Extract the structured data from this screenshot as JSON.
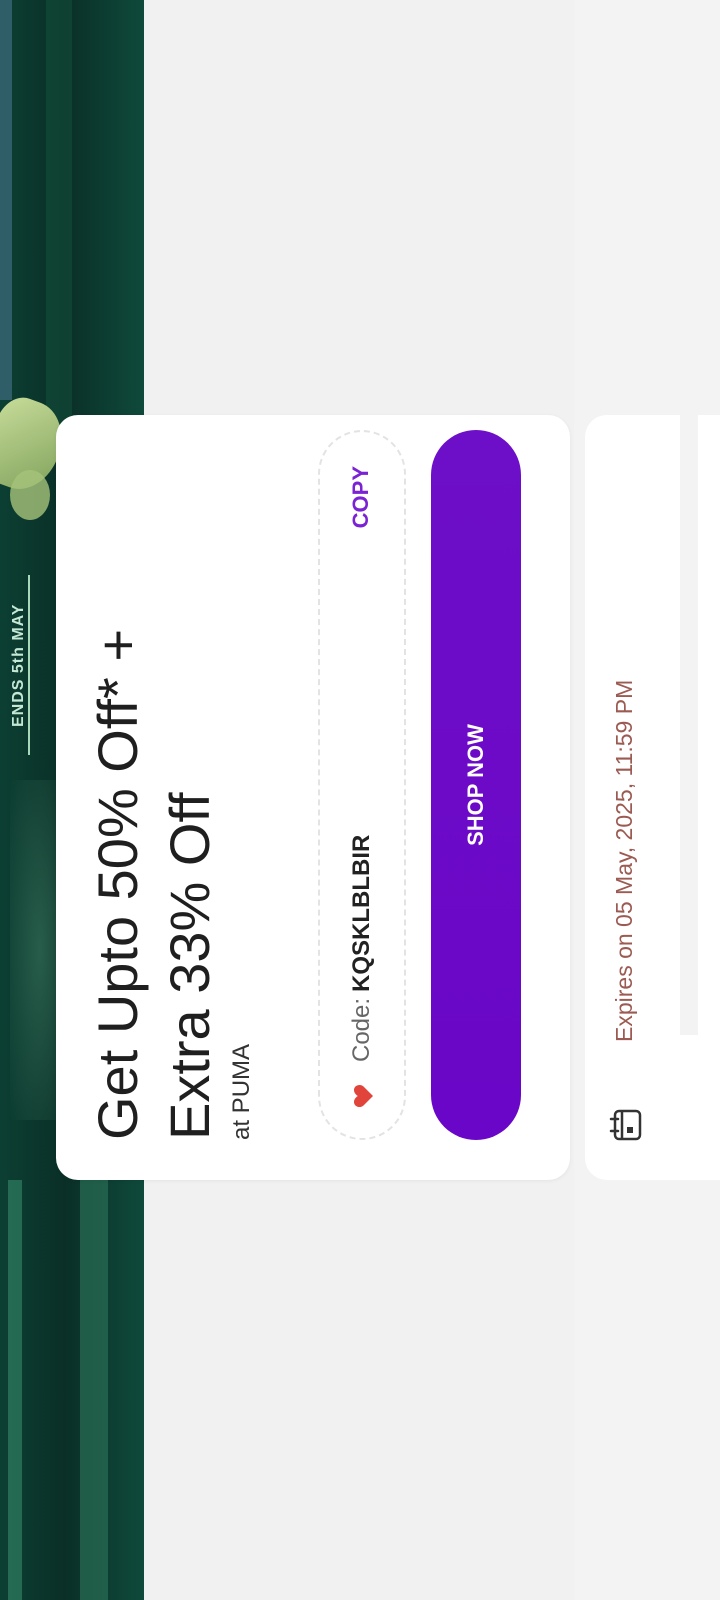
{
  "banner": {
    "text": "ENDS 5th MAY"
  },
  "offer": {
    "title": "Get Upto 50% Off* +\nExtra 33% Off",
    "brand": "at PUMA",
    "code_label": "Code:",
    "code_value": "KQSKLBLBIR",
    "copy_label": "COPY",
    "shop_label": "SHOP NOW",
    "heart_icon": "heart-icon",
    "accent_color": "#6a06c7"
  },
  "expiry": {
    "text": "Expires on 05 May, 2025, 11:59 PM",
    "icon": "calendar-icon"
  }
}
